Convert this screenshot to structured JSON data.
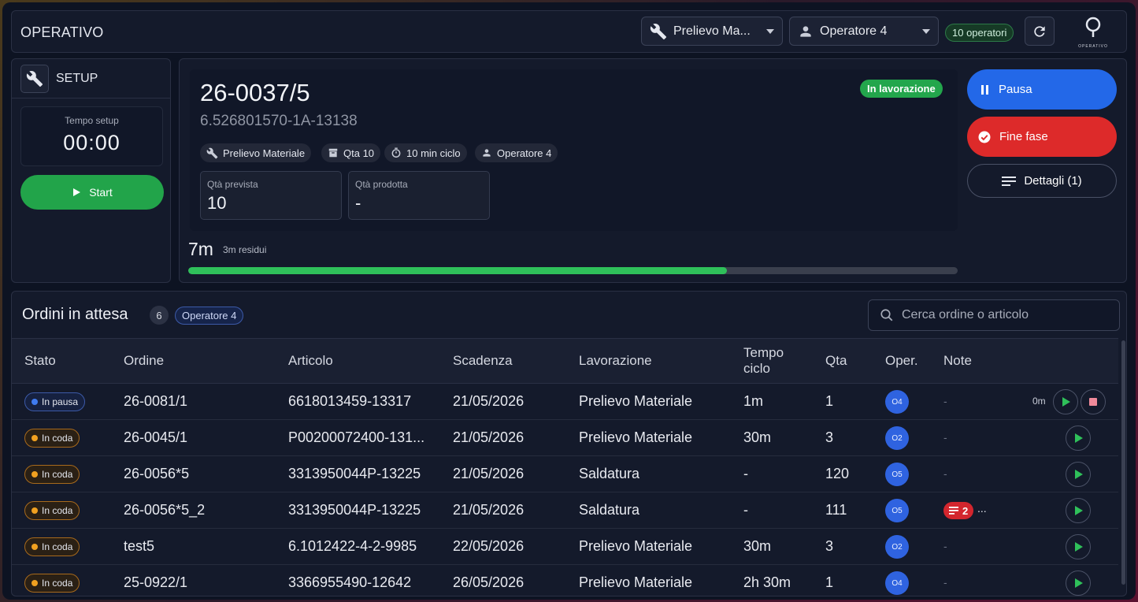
{
  "header": {
    "title": "OPERATIVO",
    "phase_dropdown": "Prelievo Ma...",
    "operator_dropdown": "Operatore 4",
    "operators_badge": "10 operatori",
    "logo_text": "OPERATIVO"
  },
  "setup": {
    "title": "SETUP",
    "timer_label": "Tempo setup",
    "timer_value": "00:00",
    "start_label": "Start"
  },
  "current_job": {
    "code": "26-0037/5",
    "article": "6.526801570-1A-13138",
    "status": "In lavorazione",
    "chips": {
      "phase": "Prelievo Materiale",
      "qty": "Qta 10",
      "cycle": "10 min ciclo",
      "operator": "Operatore 4"
    },
    "planned_label": "Qtà prevista",
    "planned_value": "10",
    "produced_label": "Qtà prodotta",
    "produced_value": "-",
    "elapsed": "7m",
    "remaining": "3m residui",
    "progress_fraction": 0.7,
    "actions": {
      "pause": "Pausa",
      "end_phase": "Fine fase",
      "details": "Dettagli (1)"
    }
  },
  "orders": {
    "title": "Ordini in attesa",
    "count": "6",
    "operator_filter": "Operatore 4",
    "search_placeholder": "Cerca ordine o articolo",
    "columns": {
      "stato": "Stato",
      "ordine": "Ordine",
      "articolo": "Articolo",
      "scadenza": "Scadenza",
      "lavorazione": "Lavorazione",
      "tempo_1": "Tempo",
      "tempo_2": "ciclo",
      "qta": "Qta",
      "oper": "Oper.",
      "note": "Note"
    },
    "rows": [
      {
        "state": "In pausa",
        "order": "26-0081/1",
        "article": "6618013459-13317",
        "due": "21/05/2026",
        "process": "Prelievo Materiale",
        "cycle": "1m",
        "qty": "1",
        "op": "O4",
        "note": "-",
        "timer": "0m"
      },
      {
        "state": "In coda",
        "order": "26-0045/1",
        "article": "P00200072400-131...",
        "due": "21/05/2026",
        "process": "Prelievo Materiale",
        "cycle": "30m",
        "qty": "3",
        "op": "O2",
        "note": "-"
      },
      {
        "state": "In coda",
        "order": "26-0056*5",
        "article": "3313950044P-13225",
        "due": "21/05/2026",
        "process": "Saldatura",
        "cycle": "-",
        "qty": "120",
        "op": "O5",
        "note": "-"
      },
      {
        "state": "In coda",
        "order": "26-0056*5_2",
        "article": "3313950044P-13225",
        "due": "21/05/2026",
        "process": "Saldatura",
        "cycle": "-",
        "qty": "111",
        "op": "O5",
        "note_count": "2",
        "note_more": "..."
      },
      {
        "state": "In coda",
        "order": "test5",
        "article": "6.1012422-4-2-9985",
        "due": "22/05/2026",
        "process": "Prelievo Materiale",
        "cycle": "30m",
        "qty": "3",
        "op": "O2",
        "note": "-"
      },
      {
        "state": "In coda",
        "order": "25-0922/1",
        "article": "3366955490-12642",
        "due": "26/05/2026",
        "process": "Prelievo Materiale",
        "cycle": "2h 30m",
        "qty": "1",
        "op": "O4",
        "note": "-"
      }
    ]
  },
  "colors": {
    "accent_blue": "#2368e8",
    "danger_red": "#dd2a2a",
    "success_green": "#22a44a",
    "pause_dot": "#3f7bf0",
    "queue_dot": "#f0a020"
  },
  "icons": [
    "wrench-icon",
    "person-icon",
    "refresh-icon",
    "play-icon",
    "pause-icon",
    "check-circle-icon",
    "list-icon",
    "box-icon",
    "stopwatch-icon",
    "search-icon",
    "stop-icon",
    "note-icon"
  ]
}
